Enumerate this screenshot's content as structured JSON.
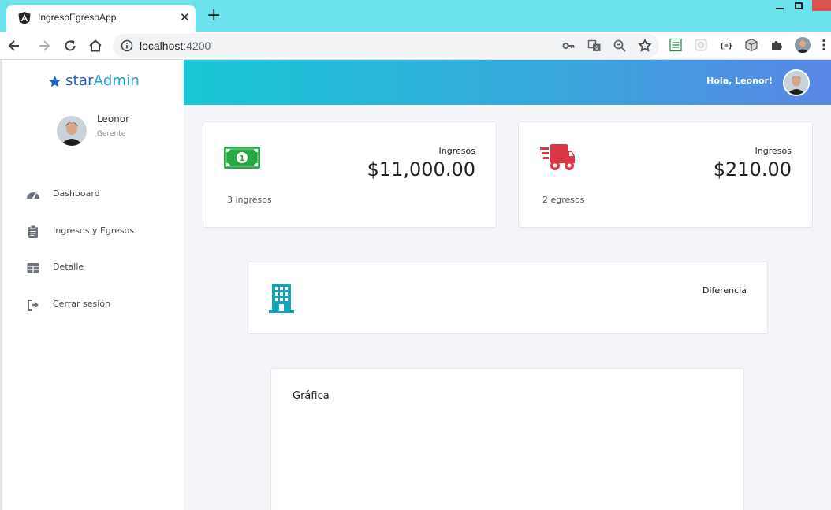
{
  "browser": {
    "tab_title": "IngresoEgresoApp",
    "tab_close": "✕",
    "new_tab": "+",
    "url_host": "localhost",
    "url_port": ":4200"
  },
  "sidebar": {
    "brand_part1": "star",
    "brand_part2": "Admin",
    "user_name": "Leonor",
    "user_role": "Gerente",
    "items": [
      {
        "label": "Dashboard",
        "icon": "dashboard-icon"
      },
      {
        "label": "Ingresos y Egresos",
        "icon": "clipboard-icon"
      },
      {
        "label": "Detalle",
        "icon": "table-icon"
      },
      {
        "label": "Cerrar sesión",
        "icon": "logout-icon"
      }
    ]
  },
  "header": {
    "greeting": "Hola, Leonor!"
  },
  "cards": {
    "ingresos": {
      "label": "Ingresos",
      "value": "$11,000.00",
      "sub": "3 ingresos",
      "icon": "money-bill-icon",
      "color": "#28a745"
    },
    "egresos": {
      "label": "Ingresos",
      "value": "$210.00",
      "sub": "2 egresos",
      "icon": "delivery-truck-icon",
      "color": "#dc3545"
    },
    "diferencia": {
      "label": "Diferencia",
      "icon": "building-icon",
      "color": "#17a2b8"
    },
    "grafica": {
      "title": "Gráfica"
    }
  },
  "colors": {
    "accent_blue": "#1aa6d8",
    "brand_dark": "#1f5fc8",
    "header_start": "#18c8d6",
    "header_end": "#5a86e6",
    "browser_frame": "#6ce2ed"
  }
}
